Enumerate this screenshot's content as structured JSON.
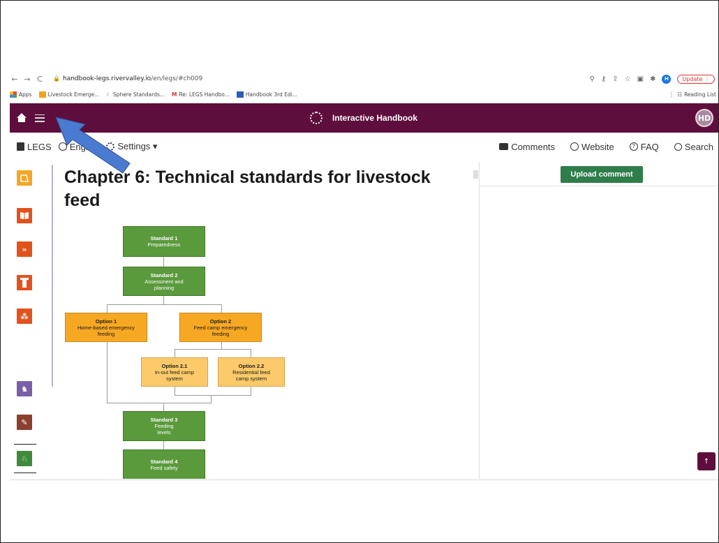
{
  "browser": {
    "nav_back": "←",
    "nav_forward": "→",
    "nav_reload": "C",
    "url_host": "handbook-legs.rivervalley.io",
    "url_path": "/en/legs/#ch009",
    "profile_initial": "H",
    "update_label": "Update"
  },
  "bookmarks": {
    "apps": "Apps",
    "items": [
      "Livestock Emerge...",
      "Sphere Standards...",
      "Re: LEGS Handbo...",
      "Handbook 3rd Edi..."
    ],
    "reading_list": "Reading List"
  },
  "appbar": {
    "title": "Interactive Handbook",
    "avatar": "HD"
  },
  "toolbar": {
    "legs": "LEGS",
    "language": "English",
    "settings": "Settings ▾",
    "comments": "Comments",
    "website": "Website",
    "faq": "FAQ",
    "search": "Search"
  },
  "content": {
    "chapter_title": "Chapter 6: Technical standards for livestock feed"
  },
  "flowchart": {
    "s1": {
      "t": "Standard 1",
      "d": "Preparedness"
    },
    "s2": {
      "t": "Standard 2",
      "d": "Assessment and planning"
    },
    "o1": {
      "t": "Option 1",
      "d": "Home-based emergency feeding"
    },
    "o2": {
      "t": "Option 2",
      "d": "Feed camp emergency feeding"
    },
    "o21": {
      "t": "Option 2.1",
      "d": "In-out feed camp system"
    },
    "o22": {
      "t": "Option 2.2",
      "d": "Residential feed camp system"
    },
    "s3": {
      "t": "Standard 3",
      "d": "Feeding levels"
    },
    "s4": {
      "t": "Standard 4",
      "d": "Feed safety"
    }
  },
  "rpanel": {
    "upload": "Upload comment",
    "to_top": "↑"
  },
  "colors": {
    "brand": "#5e0e3c",
    "standard_green": "#5a9a3c",
    "option_orange": "#f7a823",
    "upload_green": "#2e7d4a",
    "annotation_arrow": "#4a7bd0"
  },
  "sidebar_icons": [
    "introduction-icon",
    "book-icon",
    "chevrons-icon",
    "pillar-icon",
    "people-icon",
    "destocking-icon",
    "vet-syringe-icon",
    "feed-icon"
  ]
}
